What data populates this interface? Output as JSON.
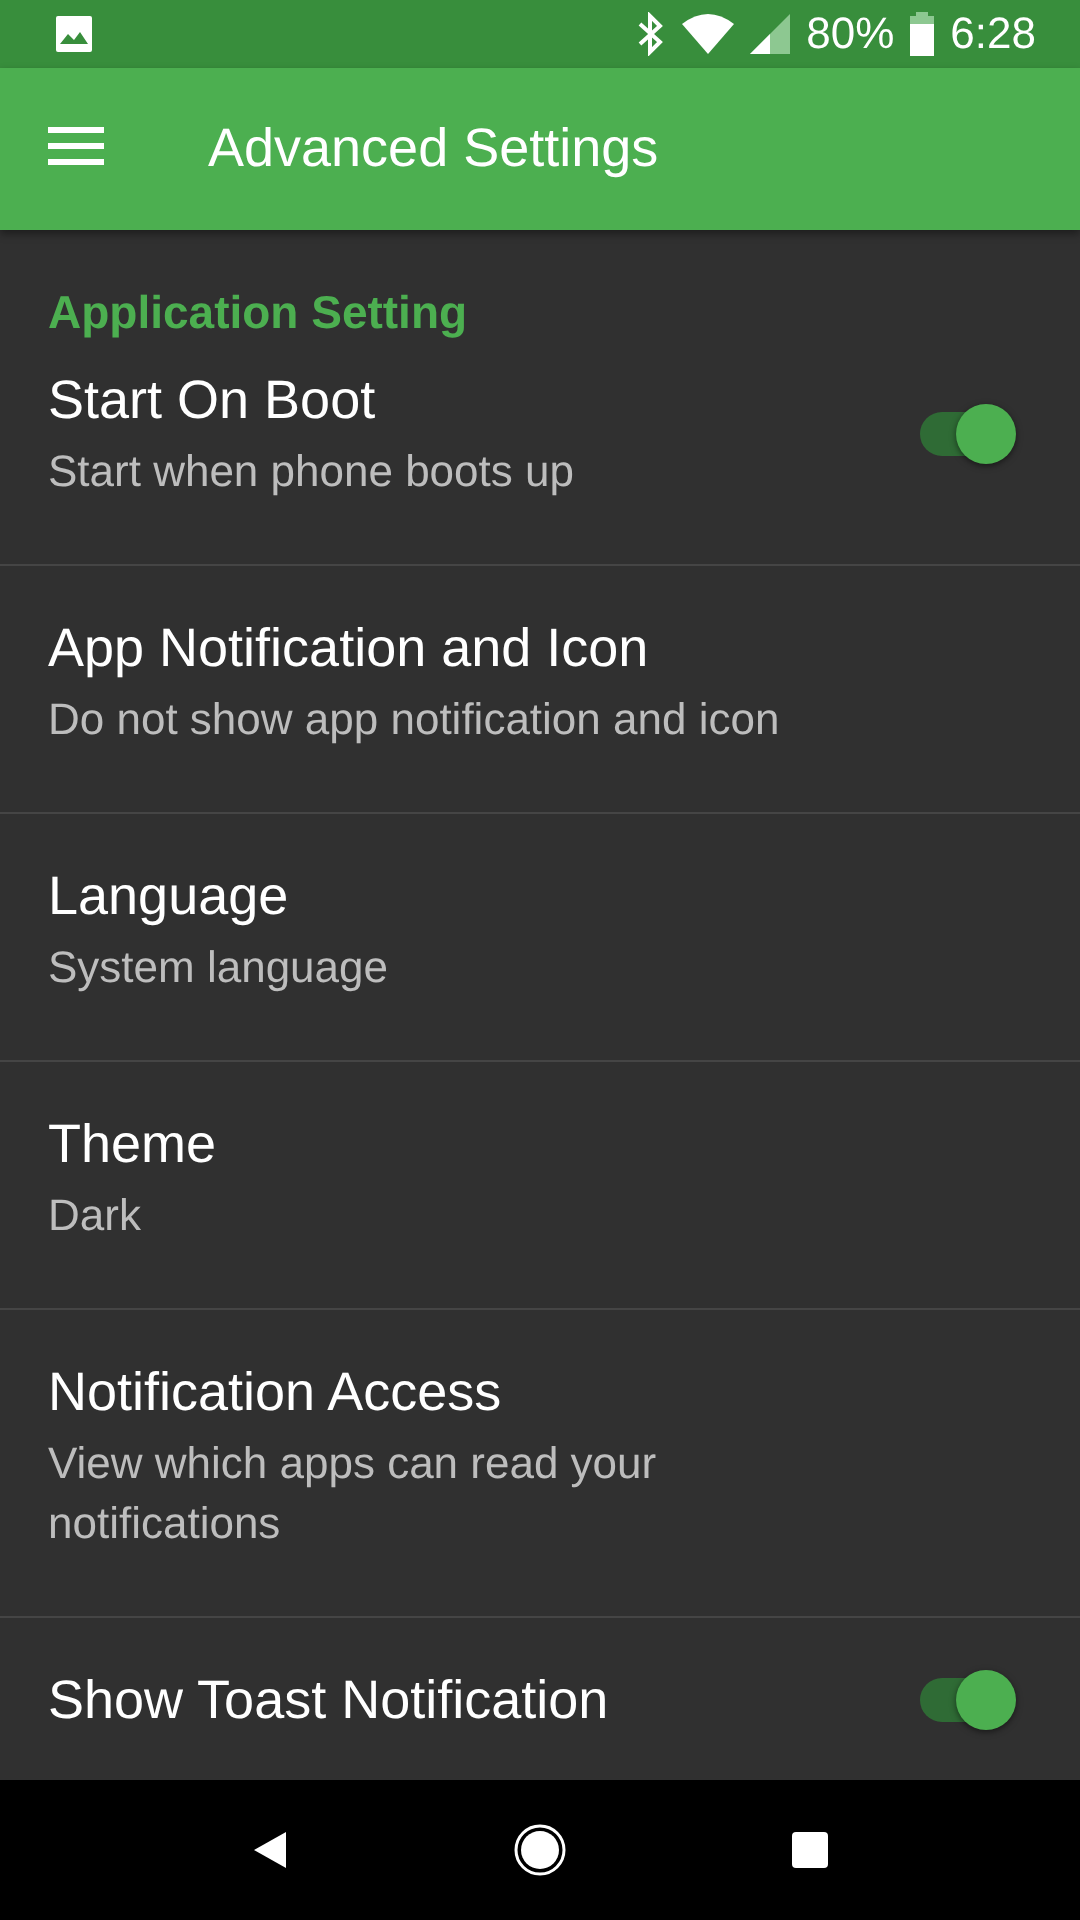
{
  "status_bar": {
    "battery": "80%",
    "time": "6:28"
  },
  "app_bar": {
    "title": "Advanced Settings"
  },
  "section": {
    "title": "Application Setting"
  },
  "items": [
    {
      "kind": "switch",
      "title": "Start On Boot",
      "subtitle": "Start when phone boots up",
      "on": true
    },
    {
      "kind": "plain",
      "title": "App Notification and Icon",
      "subtitle": "Do not show app notification and icon"
    },
    {
      "kind": "plain",
      "title": "Language",
      "subtitle": "System language"
    },
    {
      "kind": "plain",
      "title": "Theme",
      "subtitle": "Dark"
    },
    {
      "kind": "plain",
      "title": "Notification Access",
      "subtitle": "View which apps can read your notifications"
    },
    {
      "kind": "switch",
      "title": "Show Toast Notification",
      "on": true
    }
  ]
}
